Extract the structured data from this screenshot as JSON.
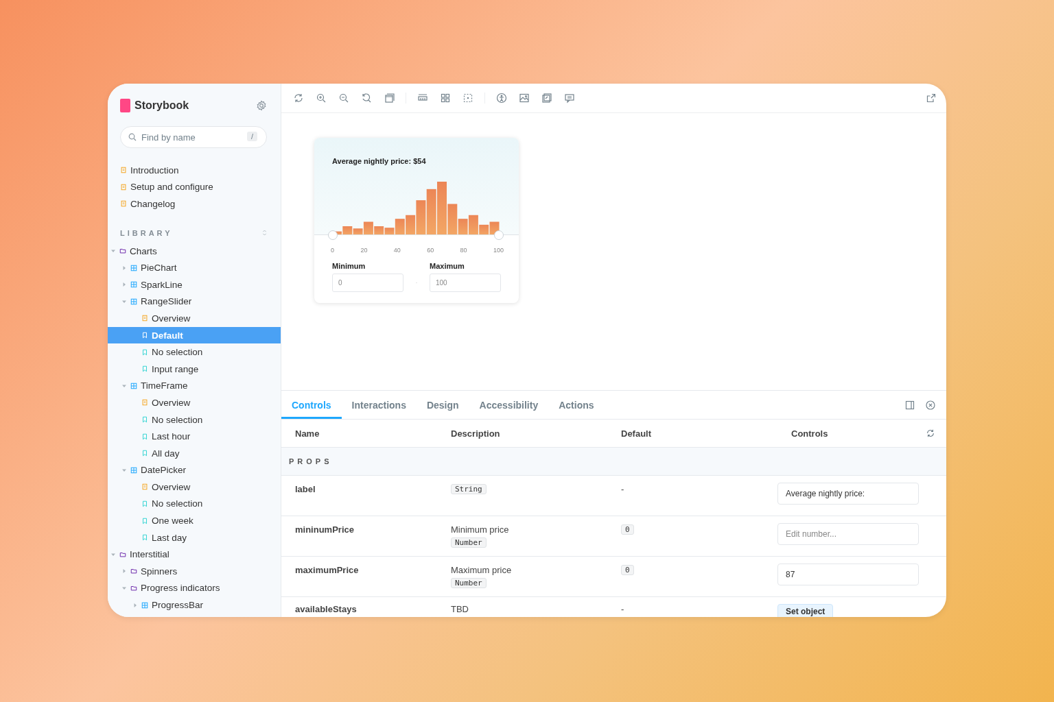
{
  "sidebar": {
    "brand": "Storybook",
    "search": {
      "placeholder": "Find by name",
      "shortcut": "/"
    },
    "docs": [
      {
        "kind": "doc",
        "label": "Introduction",
        "selected": false
      },
      {
        "kind": "doc",
        "label": "Setup and configure",
        "selected": false
      },
      {
        "kind": "doc",
        "label": "Changelog",
        "selected": false
      }
    ],
    "section": "LIBRARY",
    "tree": [
      {
        "kind": "folder",
        "label": "Charts",
        "selected": false,
        "expanded": true,
        "children": [
          {
            "kind": "component",
            "label": "PieChart",
            "selected": false,
            "expanded": false
          },
          {
            "kind": "component",
            "label": "SparkLine",
            "selected": false,
            "expanded": false
          },
          {
            "kind": "component",
            "label": "RangeSlider",
            "selected": false,
            "expanded": true,
            "children": [
              {
                "kind": "doc",
                "label": "Overview",
                "selected": false
              },
              {
                "kind": "story",
                "label": "Default",
                "selected": true
              },
              {
                "kind": "story",
                "label": "No selection",
                "selected": false
              },
              {
                "kind": "story",
                "label": "Input range",
                "selected": false
              }
            ]
          },
          {
            "kind": "component",
            "label": "TimeFrame",
            "selected": false,
            "expanded": true,
            "children": [
              {
                "kind": "doc",
                "label": "Overview",
                "selected": false
              },
              {
                "kind": "story",
                "label": "No selection",
                "selected": false
              },
              {
                "kind": "story",
                "label": "Last hour",
                "selected": false
              },
              {
                "kind": "story",
                "label": "All day",
                "selected": false
              }
            ]
          },
          {
            "kind": "component",
            "label": "DatePicker",
            "selected": false,
            "expanded": true,
            "children": [
              {
                "kind": "doc",
                "label": "Overview",
                "selected": false
              },
              {
                "kind": "story",
                "label": "No selection",
                "selected": false
              },
              {
                "kind": "story",
                "label": "One week",
                "selected": false
              },
              {
                "kind": "story",
                "label": "Last day",
                "selected": false
              }
            ]
          }
        ]
      },
      {
        "kind": "folder",
        "label": "Interstitial",
        "selected": false,
        "expanded": true,
        "children": [
          {
            "kind": "folder",
            "label": "Spinners",
            "selected": false,
            "expanded": false
          },
          {
            "kind": "folder",
            "label": "Progress indicators",
            "selected": false,
            "expanded": true,
            "children": [
              {
                "kind": "component",
                "label": "ProgressBar",
                "selected": false,
                "expanded": false
              }
            ]
          }
        ]
      }
    ]
  },
  "preview": {
    "title": "Average nightly price: $54",
    "ticks": [
      "0",
      "20",
      "40",
      "60",
      "80",
      "100"
    ],
    "minimum": {
      "label": "Minimum",
      "value": "0"
    },
    "maximum": {
      "label": "Maximum",
      "value": "100"
    }
  },
  "panel": {
    "tabs": [
      {
        "label": "Controls",
        "selected": true
      },
      {
        "label": "Interactions",
        "selected": false
      },
      {
        "label": "Design",
        "selected": false
      },
      {
        "label": "Accessibility",
        "selected": false
      },
      {
        "label": "Actions",
        "selected": false
      }
    ],
    "columns": [
      "Name",
      "Description",
      "Default",
      "Controls"
    ],
    "section": "PROPS",
    "rows": [
      {
        "name": "label",
        "type": "String",
        "default": {
          "kind": "text",
          "value": "-"
        },
        "control": {
          "kind": "text",
          "value": "Average nightly price:"
        }
      },
      {
        "name": "mininumPrice",
        "description": "Minimum price",
        "type": "Number",
        "default": {
          "kind": "code",
          "value": "0"
        },
        "control": {
          "kind": "text",
          "placeholder": "Edit number..."
        }
      },
      {
        "name": "maximumPrice",
        "description": "Maximum price",
        "type": "Number",
        "default": {
          "kind": "code",
          "value": "0"
        },
        "control": {
          "kind": "text",
          "value": "87"
        }
      },
      {
        "name": "availableStays",
        "description": "TBD",
        "default": {
          "kind": "text",
          "value": "-"
        },
        "control": {
          "kind": "button",
          "label": "Set object"
        }
      }
    ]
  }
}
